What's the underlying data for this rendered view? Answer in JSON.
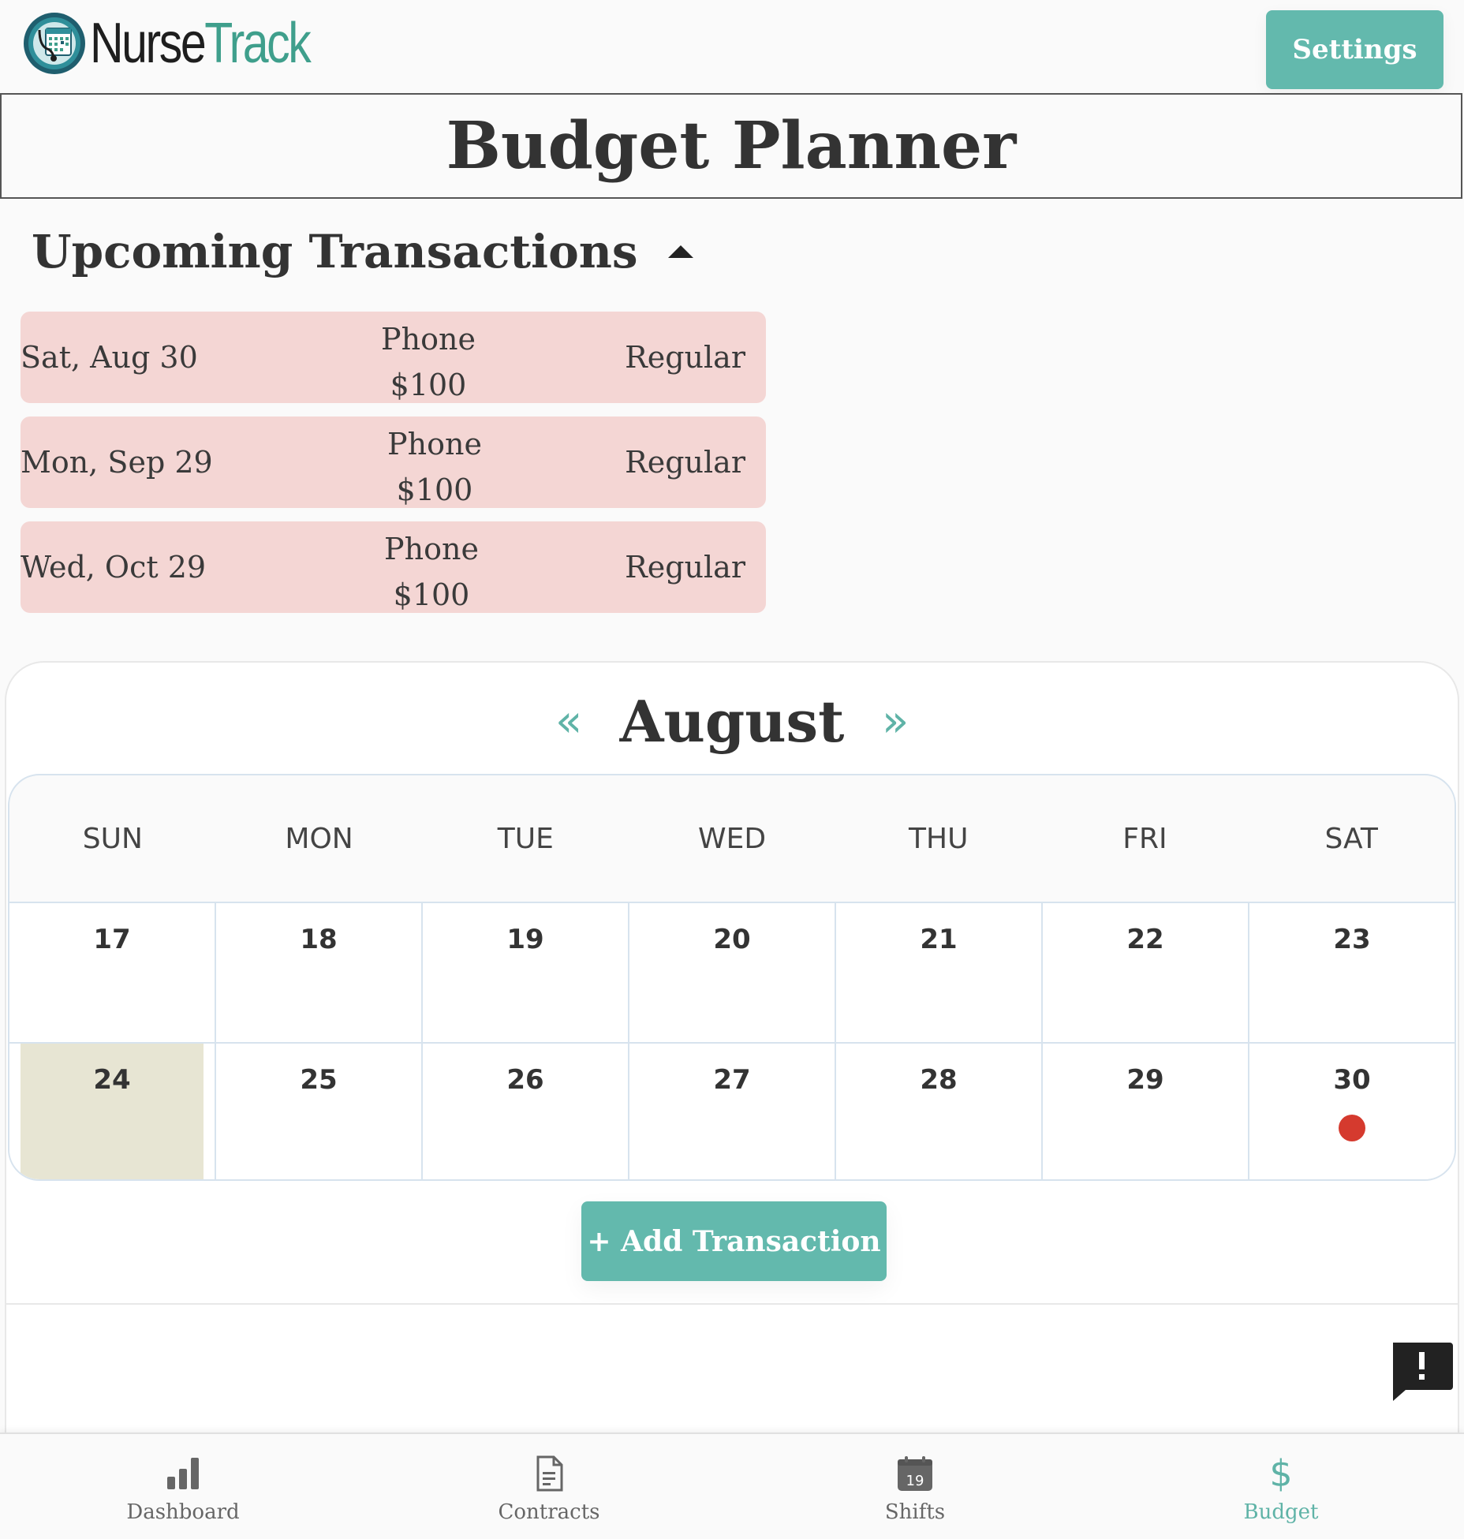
{
  "header": {
    "logo_part1": "Nurse",
    "logo_part2": "Track",
    "settings_label": "Settings"
  },
  "page_title": "Budget Planner",
  "upcoming": {
    "heading": "Upcoming Transactions",
    "items": [
      {
        "date": "Sat, Aug 30",
        "name": "Phone",
        "amount": "$100",
        "type": "Regular"
      },
      {
        "date": "Mon, Sep 29",
        "name": "Phone",
        "amount": "$100",
        "type": "Regular"
      },
      {
        "date": "Wed, Oct 29",
        "name": "Phone",
        "amount": "$100",
        "type": "Regular"
      }
    ]
  },
  "calendar": {
    "month": "August",
    "prev_arrow": "«",
    "next_arrow": "»",
    "weekdays": [
      "SUN",
      "MON",
      "TUE",
      "WED",
      "THU",
      "FRI",
      "SAT"
    ],
    "weeks": [
      [
        "17",
        "18",
        "19",
        "20",
        "21",
        "22",
        "23"
      ],
      [
        "24",
        "25",
        "26",
        "27",
        "28",
        "29",
        "30"
      ]
    ],
    "today": "24",
    "event_days": [
      "30"
    ],
    "event_color": "#d53a2e",
    "today_color": "#e7e5d3"
  },
  "add_transaction_label": "+ Add Transaction",
  "bottom_nav": [
    {
      "label": "Dashboard",
      "icon": "bar-chart-icon"
    },
    {
      "label": "Contracts",
      "icon": "document-icon"
    },
    {
      "label": "Shifts",
      "icon": "calendar-icon",
      "icon_text": "19"
    },
    {
      "label": "Budget",
      "icon": "dollar-icon",
      "icon_text": "$",
      "active": true
    }
  ],
  "colors": {
    "accent": "#63b9ad",
    "transaction_bg": "#f4d6d4",
    "logo_teal": "#3f9f8c"
  }
}
